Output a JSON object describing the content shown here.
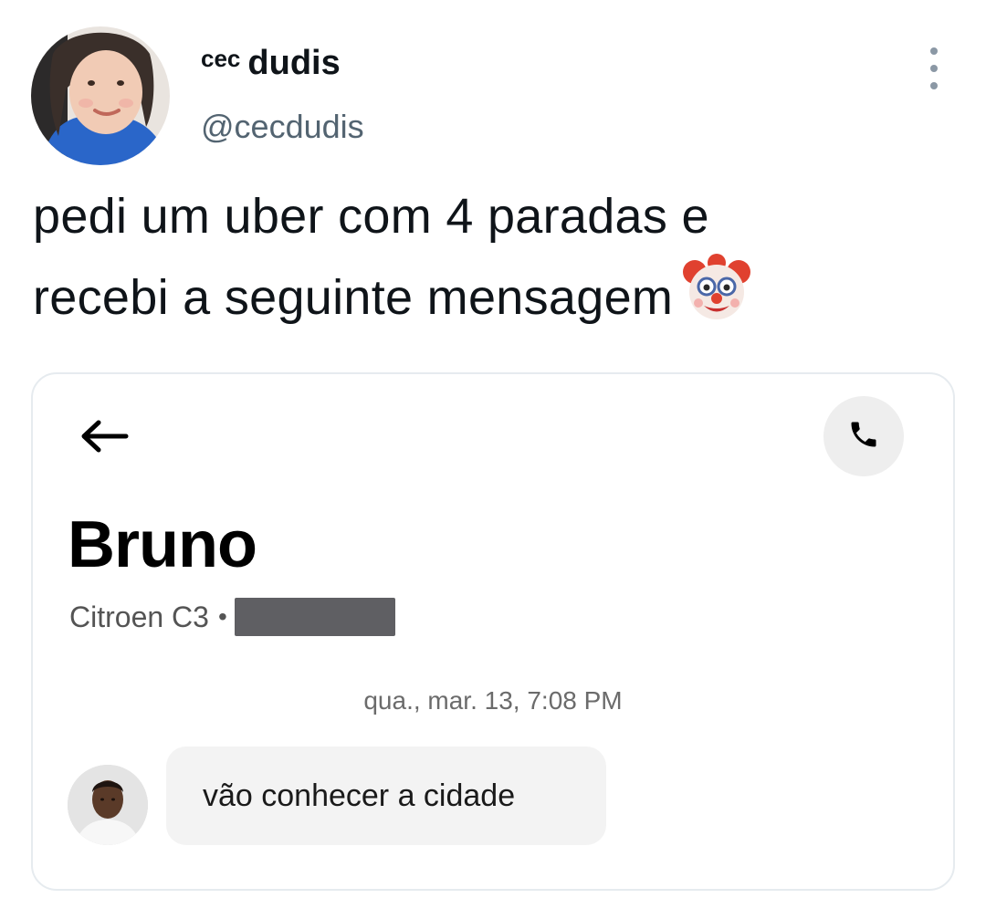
{
  "tweet": {
    "display_name_prefix": "cec",
    "display_name": "dudis",
    "handle": "@cecdudis",
    "text_line1": "pedi um uber com 4 paradas e",
    "text_line2": "recebi a seguinte mensagem",
    "emoji": "clown-face-icon"
  },
  "chat_screenshot": {
    "driver_name": "Bruno",
    "vehicle": "Citroen C3",
    "separator": "•",
    "timestamp": "qua., mar. 13, 7:08 PM",
    "messages": [
      {
        "text": "vão conhecer a cidade"
      }
    ]
  },
  "colors": {
    "text_primary": "#0f1419",
    "text_secondary": "#536471",
    "bubble_bg": "#f3f3f3",
    "call_button_bg": "#eeeeee",
    "redaction": "#5f5f63"
  }
}
